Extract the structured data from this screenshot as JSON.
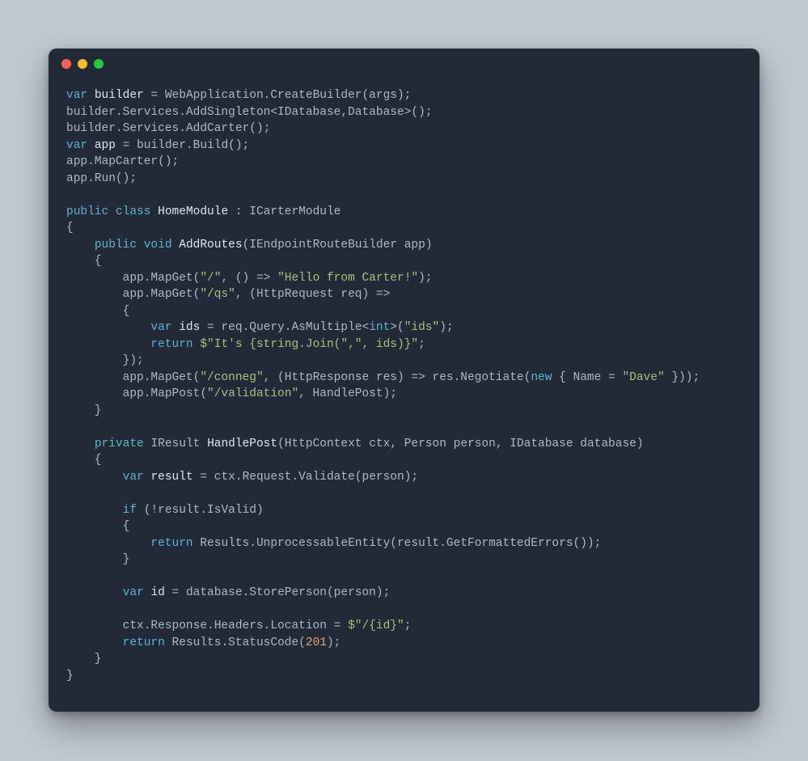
{
  "traffic_colors": {
    "close": "#ff5f57",
    "minimize": "#febc2e",
    "zoom": "#28c840"
  },
  "code_tokens": [
    [
      [
        "kw",
        "var"
      ],
      [
        "plain",
        " "
      ],
      [
        "id",
        "builder"
      ],
      [
        "plain",
        " = WebApplication.CreateBuilder(args);"
      ]
    ],
    [
      [
        "plain",
        "builder.Services.AddSingleton<IDatabase,Database>();"
      ]
    ],
    [
      [
        "plain",
        "builder.Services.AddCarter();"
      ]
    ],
    [
      [
        "kw",
        "var"
      ],
      [
        "plain",
        " "
      ],
      [
        "id",
        "app"
      ],
      [
        "plain",
        " = builder.Build();"
      ]
    ],
    [
      [
        "plain",
        "app.MapCarter();"
      ]
    ],
    [
      [
        "plain",
        "app.Run();"
      ]
    ],
    [],
    [
      [
        "kw",
        "public"
      ],
      [
        "plain",
        " "
      ],
      [
        "kw",
        "class"
      ],
      [
        "plain",
        " "
      ],
      [
        "id",
        "HomeModule"
      ],
      [
        "plain",
        " : ICarterModule"
      ]
    ],
    [
      [
        "plain",
        "{"
      ]
    ],
    [
      [
        "plain",
        "    "
      ],
      [
        "kw",
        "public"
      ],
      [
        "plain",
        " "
      ],
      [
        "kw",
        "void"
      ],
      [
        "plain",
        " "
      ],
      [
        "id",
        "AddRoutes"
      ],
      [
        "plain",
        "(IEndpointRouteBuilder app)"
      ]
    ],
    [
      [
        "plain",
        "    {"
      ]
    ],
    [
      [
        "plain",
        "        app.MapGet("
      ],
      [
        "str",
        "\"/\""
      ],
      [
        "plain",
        ", () => "
      ],
      [
        "str",
        "\"Hello from Carter!\""
      ],
      [
        "plain",
        ");"
      ]
    ],
    [
      [
        "plain",
        "        app.MapGet("
      ],
      [
        "str",
        "\"/qs\""
      ],
      [
        "plain",
        ", (HttpRequest req) =>"
      ]
    ],
    [
      [
        "plain",
        "        {"
      ]
    ],
    [
      [
        "plain",
        "            "
      ],
      [
        "kw",
        "var"
      ],
      [
        "plain",
        " "
      ],
      [
        "id",
        "ids"
      ],
      [
        "plain",
        " = req.Query.AsMultiple<"
      ],
      [
        "ty",
        "int"
      ],
      [
        "plain",
        ">("
      ],
      [
        "str",
        "\"ids\""
      ],
      [
        "plain",
        ");"
      ]
    ],
    [
      [
        "plain",
        "            "
      ],
      [
        "kw",
        "return"
      ],
      [
        "plain",
        " "
      ],
      [
        "str",
        "$\"It's {string.Join(\",\", ids)}\""
      ],
      [
        "plain",
        ";"
      ]
    ],
    [
      [
        "plain",
        "        });"
      ]
    ],
    [
      [
        "plain",
        "        app.MapGet("
      ],
      [
        "str",
        "\"/conneg\""
      ],
      [
        "plain",
        ", (HttpResponse res) => res.Negotiate("
      ],
      [
        "kw",
        "new"
      ],
      [
        "plain",
        " { Name = "
      ],
      [
        "str",
        "\"Dave\""
      ],
      [
        "plain",
        " }));"
      ]
    ],
    [
      [
        "plain",
        "        app.MapPost("
      ],
      [
        "str",
        "\"/validation\""
      ],
      [
        "plain",
        ", HandlePost);"
      ]
    ],
    [
      [
        "plain",
        "    }"
      ]
    ],
    [],
    [
      [
        "plain",
        "    "
      ],
      [
        "kw",
        "private"
      ],
      [
        "plain",
        " IResult "
      ],
      [
        "id",
        "HandlePost"
      ],
      [
        "plain",
        "(HttpContext ctx, Person person, IDatabase database)"
      ]
    ],
    [
      [
        "plain",
        "    {"
      ]
    ],
    [
      [
        "plain",
        "        "
      ],
      [
        "kw",
        "var"
      ],
      [
        "plain",
        " "
      ],
      [
        "id",
        "result"
      ],
      [
        "plain",
        " = ctx.Request.Validate(person);"
      ]
    ],
    [],
    [
      [
        "plain",
        "        "
      ],
      [
        "kw",
        "if"
      ],
      [
        "plain",
        " (!result.IsValid)"
      ]
    ],
    [
      [
        "plain",
        "        {"
      ]
    ],
    [
      [
        "plain",
        "            "
      ],
      [
        "kw",
        "return"
      ],
      [
        "plain",
        " Results.UnprocessableEntity(result.GetFormattedErrors());"
      ]
    ],
    [
      [
        "plain",
        "        }"
      ]
    ],
    [],
    [
      [
        "plain",
        "        "
      ],
      [
        "kw",
        "var"
      ],
      [
        "plain",
        " "
      ],
      [
        "id",
        "id"
      ],
      [
        "plain",
        " = database.StorePerson(person);"
      ]
    ],
    [],
    [
      [
        "plain",
        "        ctx.Response.Headers.Location = "
      ],
      [
        "str",
        "$\"/{id}\""
      ],
      [
        "plain",
        ";"
      ]
    ],
    [
      [
        "plain",
        "        "
      ],
      [
        "kw",
        "return"
      ],
      [
        "plain",
        " Results.StatusCode("
      ],
      [
        "num",
        "201"
      ],
      [
        "plain",
        ");"
      ]
    ],
    [
      [
        "plain",
        "    }"
      ]
    ],
    [
      [
        "plain",
        "}"
      ]
    ]
  ]
}
